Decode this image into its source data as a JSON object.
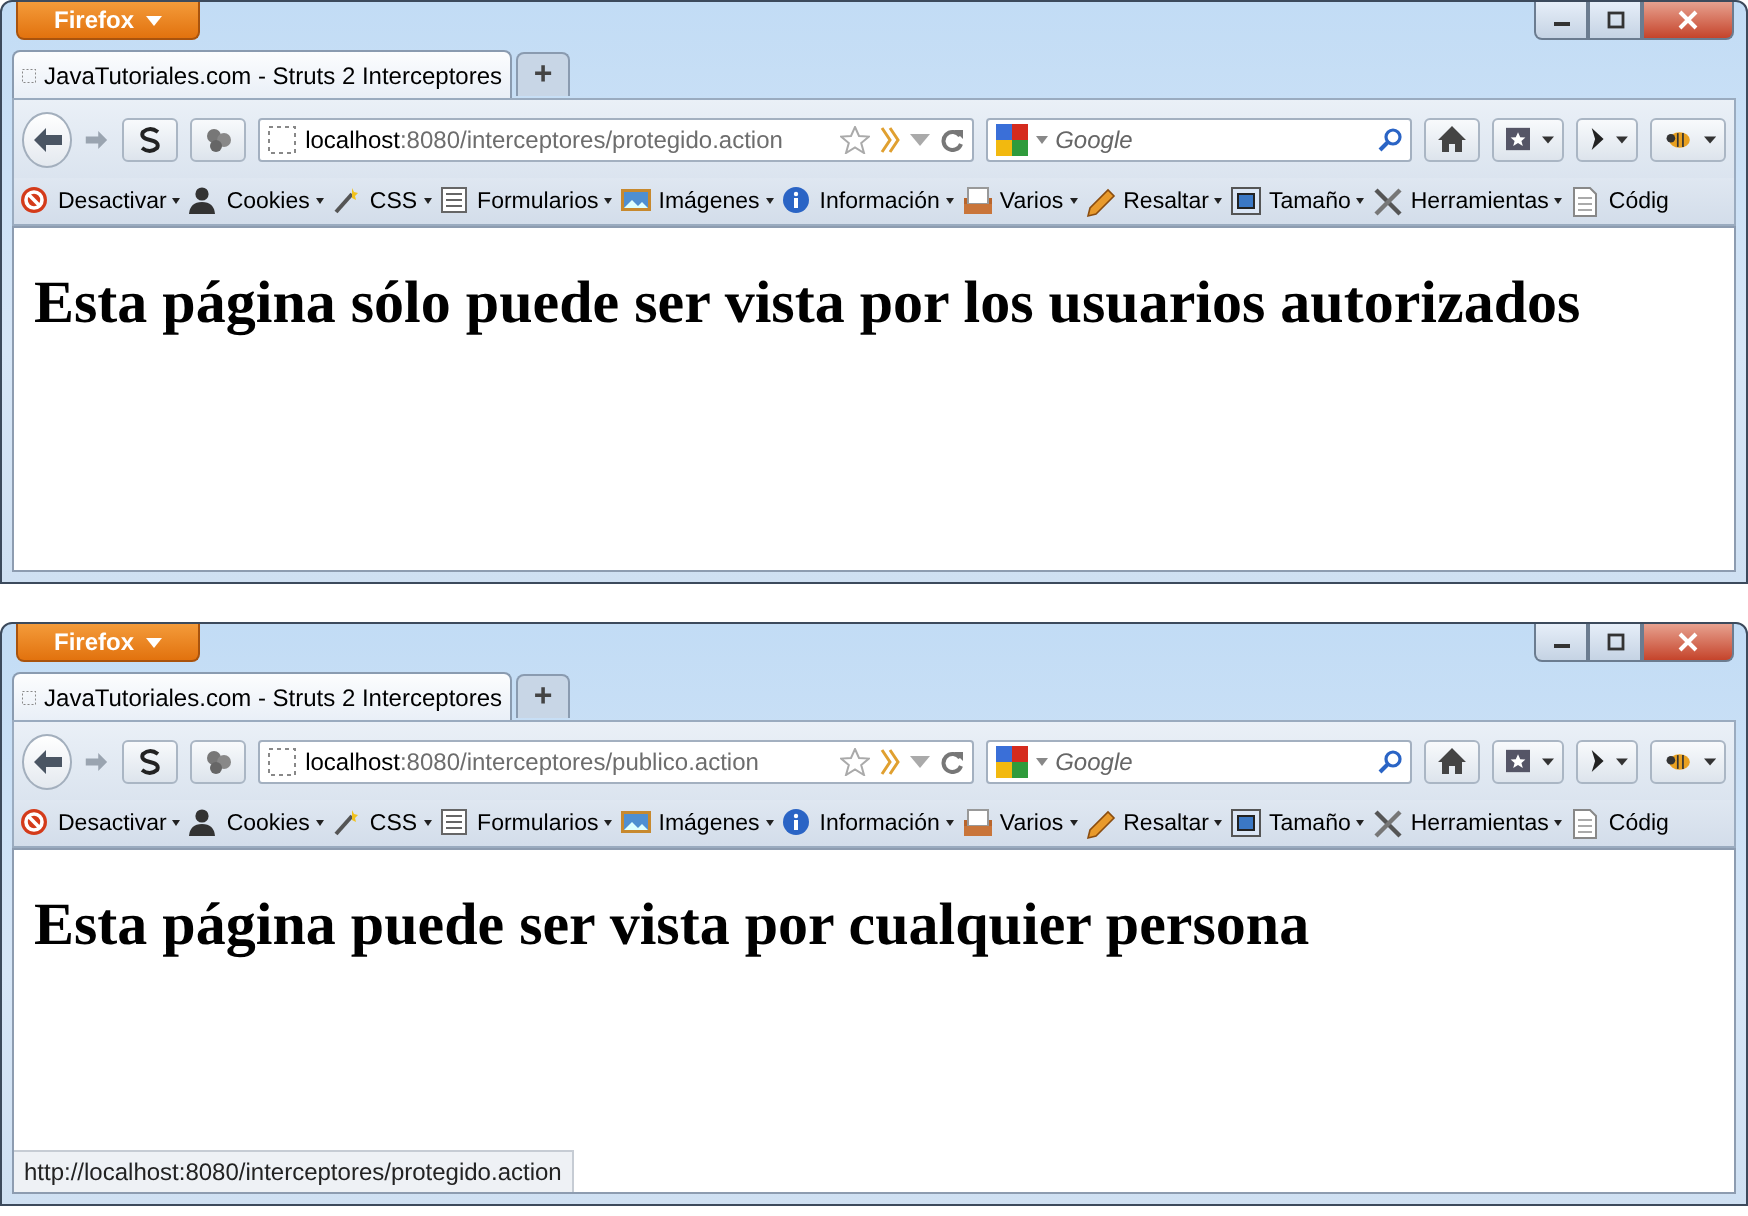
{
  "windows": [
    {
      "app_menu": "Firefox",
      "tab": {
        "title": "JavaTutoriales.com - Struts 2 Interceptores",
        "selected": true
      },
      "new_tab": "+",
      "address": {
        "host": "localhost",
        "path": ":8080/interceptores/protegido.action"
      },
      "search": {
        "placeholder": "Google"
      },
      "toolbar": [
        {
          "label": "Desactivar",
          "kind": "block",
          "dropdown": true
        },
        {
          "label": "Cookies",
          "kind": "person",
          "dropdown": true
        },
        {
          "label": "CSS",
          "kind": "wand",
          "dropdown": true
        },
        {
          "label": "Formularios",
          "kind": "form",
          "dropdown": true
        },
        {
          "label": "Imágenes",
          "kind": "image",
          "dropdown": true
        },
        {
          "label": "Información",
          "kind": "info",
          "dropdown": true
        },
        {
          "label": "Varios",
          "kind": "tray",
          "dropdown": true
        },
        {
          "label": "Resaltar",
          "kind": "pencil",
          "dropdown": true
        },
        {
          "label": "Tamaño",
          "kind": "crop",
          "dropdown": true
        },
        {
          "label": "Herramientas",
          "kind": "tools",
          "dropdown": true
        },
        {
          "label": "Códig",
          "kind": "doc",
          "dropdown": false
        }
      ],
      "heading": "Esta página sólo puede ser vista por los usuarios autorizados"
    },
    {
      "app_menu": "Firefox",
      "tab": {
        "title": "JavaTutoriales.com - Struts 2 Interceptores",
        "selected": true
      },
      "new_tab": "+",
      "address": {
        "host": "localhost",
        "path": ":8080/interceptores/publico.action"
      },
      "search": {
        "placeholder": "Google"
      },
      "toolbar": [
        {
          "label": "Desactivar",
          "kind": "block",
          "dropdown": true
        },
        {
          "label": "Cookies",
          "kind": "person",
          "dropdown": true
        },
        {
          "label": "CSS",
          "kind": "wand",
          "dropdown": true
        },
        {
          "label": "Formularios",
          "kind": "form",
          "dropdown": true
        },
        {
          "label": "Imágenes",
          "kind": "image",
          "dropdown": true
        },
        {
          "label": "Información",
          "kind": "info",
          "dropdown": true
        },
        {
          "label": "Varios",
          "kind": "tray",
          "dropdown": true
        },
        {
          "label": "Resaltar",
          "kind": "pencil",
          "dropdown": true
        },
        {
          "label": "Tamaño",
          "kind": "crop",
          "dropdown": true
        },
        {
          "label": "Herramientas",
          "kind": "tools",
          "dropdown": true
        },
        {
          "label": "Códig",
          "kind": "doc",
          "dropdown": false
        }
      ],
      "heading": "Esta página puede ser vista por cualquier persona",
      "status_bar": "http://localhost:8080/interceptores/protegido.action"
    }
  ]
}
